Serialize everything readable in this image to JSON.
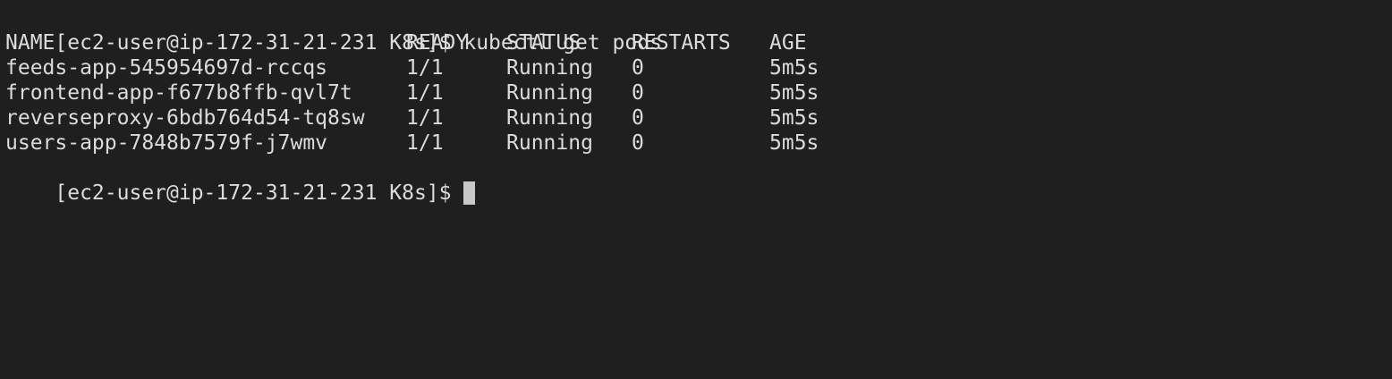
{
  "terminal": {
    "prompt_line_1": "[ec2-user@ip-172-31-21-231 K8s]$ kubectl get pods",
    "prompt_line_2": "[ec2-user@ip-172-31-21-231 K8s]$ ",
    "cursor_color": "#c8c8c8",
    "background_color": "#1f1f1f",
    "text_color": "#dcdcdc"
  },
  "table": {
    "headers": [
      "NAME",
      "READY",
      "STATUS",
      "RESTARTS",
      "AGE"
    ],
    "rows": [
      [
        "feeds-app-545954697d-rccqs",
        "1/1",
        "Running",
        "0",
        "5m5s"
      ],
      [
        "frontend-app-f677b8ffb-qvl7t",
        "1/1",
        "Running",
        "0",
        "5m5s"
      ],
      [
        "reverseproxy-6bdb764d54-tq8sw",
        "1/1",
        "Running",
        "0",
        "5m5s"
      ],
      [
        "users-app-7848b7579f-j7wmv",
        "1/1",
        "Running",
        "0",
        "5m5s"
      ]
    ]
  }
}
